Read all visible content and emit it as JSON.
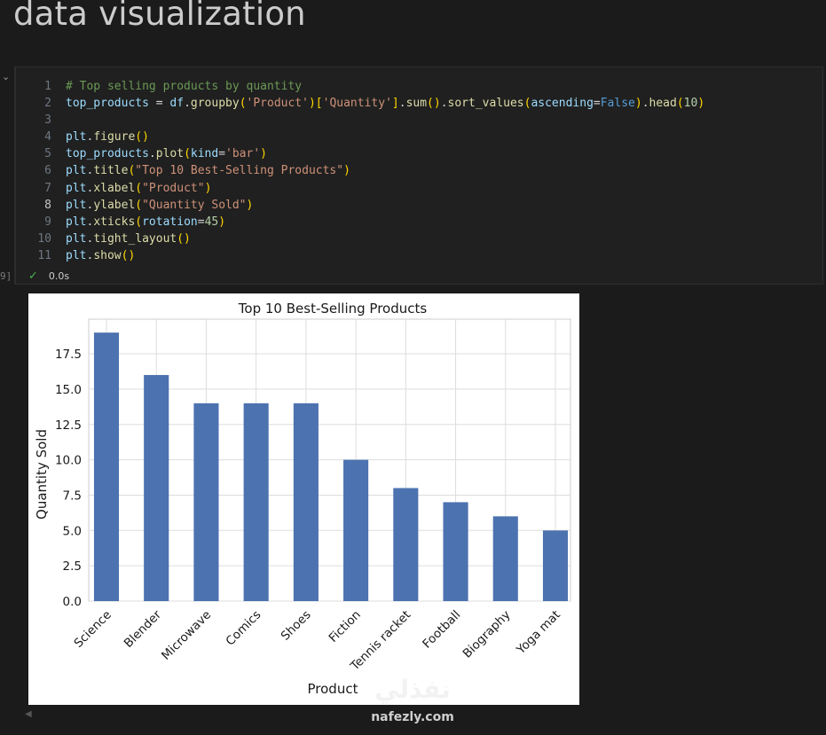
{
  "page": {
    "heading": "data visualization",
    "collapse_glyph": "⌄",
    "exec_marker": "9]"
  },
  "code_cell": {
    "lines": [
      {
        "n": "1",
        "tokens": [
          [
            "cm",
            "# Top selling products by quantity"
          ]
        ]
      },
      {
        "n": "2",
        "tokens": [
          [
            "var",
            "top_products"
          ],
          [
            "pl",
            " = "
          ],
          [
            "var",
            "df"
          ],
          [
            "pl",
            "."
          ],
          [
            "fn",
            "groupby"
          ],
          [
            "br1",
            "("
          ],
          [
            "str",
            "'Product'"
          ],
          [
            "br1",
            ")"
          ],
          [
            "br1",
            "["
          ],
          [
            "str",
            "'Quantity'"
          ],
          [
            "br1",
            "]"
          ],
          [
            "pl",
            "."
          ],
          [
            "fn",
            "sum"
          ],
          [
            "br1",
            "()"
          ],
          [
            "pl",
            "."
          ],
          [
            "fn",
            "sort_values"
          ],
          [
            "br1",
            "("
          ],
          [
            "var",
            "ascending"
          ],
          [
            "pl",
            "="
          ],
          [
            "kw",
            "False"
          ],
          [
            "br1",
            ")"
          ],
          [
            "pl",
            "."
          ],
          [
            "fn",
            "head"
          ],
          [
            "br1",
            "("
          ],
          [
            "num",
            "10"
          ],
          [
            "br1",
            ")"
          ]
        ]
      },
      {
        "n": "3",
        "tokens": []
      },
      {
        "n": "4",
        "tokens": [
          [
            "var",
            "plt"
          ],
          [
            "pl",
            "."
          ],
          [
            "fn",
            "figure"
          ],
          [
            "br1",
            "()"
          ]
        ]
      },
      {
        "n": "5",
        "tokens": [
          [
            "var",
            "top_products"
          ],
          [
            "pl",
            "."
          ],
          [
            "fn",
            "plot"
          ],
          [
            "br1",
            "("
          ],
          [
            "var",
            "kind"
          ],
          [
            "pl",
            "="
          ],
          [
            "str",
            "'bar'"
          ],
          [
            "br1",
            ")"
          ]
        ]
      },
      {
        "n": "6",
        "tokens": [
          [
            "var",
            "plt"
          ],
          [
            "pl",
            "."
          ],
          [
            "fn",
            "title"
          ],
          [
            "br1",
            "("
          ],
          [
            "str",
            "\"Top 10 Best-Selling Products\""
          ],
          [
            "br1",
            ")"
          ]
        ]
      },
      {
        "n": "7",
        "tokens": [
          [
            "var",
            "plt"
          ],
          [
            "pl",
            "."
          ],
          [
            "fn",
            "xlabel"
          ],
          [
            "br1",
            "("
          ],
          [
            "str",
            "\"Product\""
          ],
          [
            "br1",
            ")"
          ]
        ]
      },
      {
        "n": "8",
        "active": true,
        "tokens": [
          [
            "var",
            "plt"
          ],
          [
            "pl",
            "."
          ],
          [
            "fn",
            "ylabel"
          ],
          [
            "br1",
            "("
          ],
          [
            "str",
            "\"Quantity Sold\""
          ],
          [
            "br1",
            ")"
          ]
        ]
      },
      {
        "n": "9",
        "tokens": [
          [
            "var",
            "plt"
          ],
          [
            "pl",
            "."
          ],
          [
            "fn",
            "xticks"
          ],
          [
            "br1",
            "("
          ],
          [
            "var",
            "rotation"
          ],
          [
            "pl",
            "="
          ],
          [
            "num",
            "45"
          ],
          [
            "br1",
            ")"
          ]
        ]
      },
      {
        "n": "10",
        "tokens": [
          [
            "var",
            "plt"
          ],
          [
            "pl",
            "."
          ],
          [
            "fn",
            "tight_layout"
          ],
          [
            "br1",
            "()"
          ]
        ]
      },
      {
        "n": "11",
        "tokens": [
          [
            "var",
            "plt"
          ],
          [
            "pl",
            "."
          ],
          [
            "fn",
            "show"
          ],
          [
            "br1",
            "()"
          ]
        ]
      }
    ],
    "status": {
      "check_icon": "✓",
      "time": "0.0s"
    }
  },
  "chart_data": {
    "type": "bar",
    "title": "Top 10 Best-Selling Products",
    "xlabel": "Product",
    "ylabel": "Quantity Sold",
    "categories": [
      "Science",
      "Blender",
      "Microwave",
      "Comics",
      "Shoes",
      "Fiction",
      "Tennis racket",
      "Football",
      "Biography",
      "Yoga mat"
    ],
    "values": [
      19,
      16,
      14,
      14,
      14,
      10,
      8,
      7,
      6,
      5
    ],
    "yticks": [
      "0.0",
      "2.5",
      "5.0",
      "7.5",
      "10.0",
      "12.5",
      "15.0",
      "17.5"
    ],
    "ylim": [
      0,
      19.95
    ],
    "bar_color": "#4c72b0",
    "grid": true,
    "style": "seaborn-whitegrid",
    "tick_rotation": 45
  },
  "watermark": {
    "arabic": "نفذلي",
    "url": "nafezly.com"
  }
}
